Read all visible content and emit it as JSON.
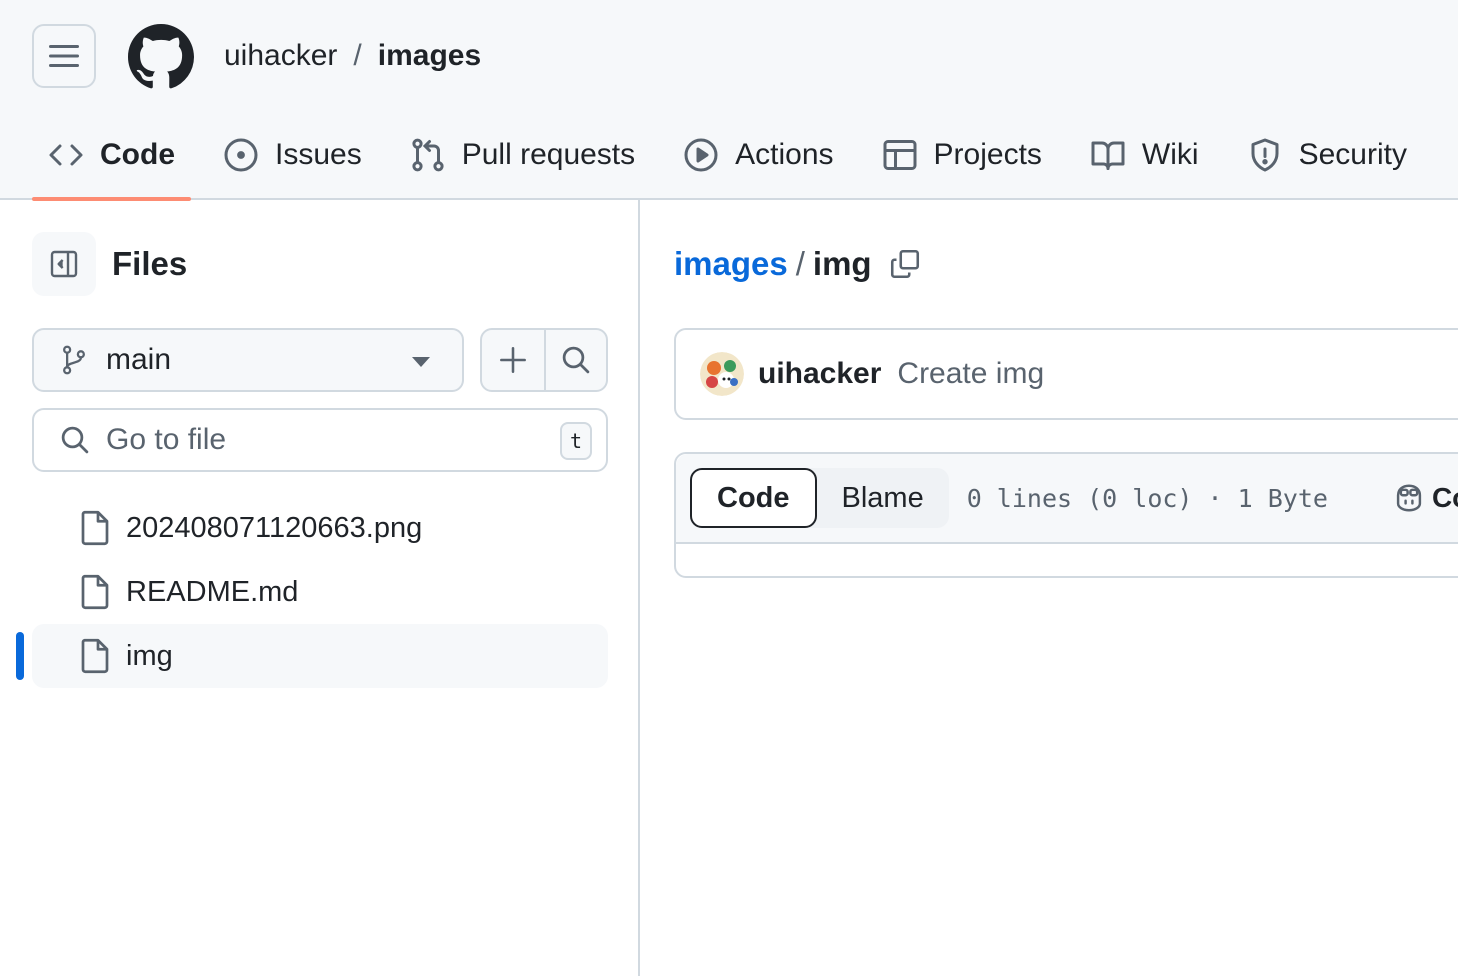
{
  "header": {
    "owner": "uihacker",
    "separator": "/",
    "repo": "images"
  },
  "tabs": [
    {
      "label": "Code",
      "icon": "code-icon",
      "active": true
    },
    {
      "label": "Issues",
      "icon": "issue-opened-icon"
    },
    {
      "label": "Pull requests",
      "icon": "git-pull-request-icon"
    },
    {
      "label": "Actions",
      "icon": "play-icon"
    },
    {
      "label": "Projects",
      "icon": "table-icon"
    },
    {
      "label": "Wiki",
      "icon": "book-icon"
    },
    {
      "label": "Security",
      "icon": "shield-icon"
    }
  ],
  "sidebar": {
    "title": "Files",
    "branch": "main",
    "goto_placeholder": "Go to file",
    "goto_shortcut": "t",
    "files": [
      {
        "name": "202408071120663.png"
      },
      {
        "name": "README.md"
      },
      {
        "name": "img",
        "selected": true
      }
    ]
  },
  "main": {
    "breadcrumb": {
      "repo": "images",
      "separator": "/",
      "file": "img"
    },
    "commit": {
      "author": "uihacker",
      "message": "Create img"
    },
    "file_header": {
      "view_code": "Code",
      "view_blame": "Blame",
      "meta": "0 lines (0 loc) · 1 Byte",
      "copilot_label": "Cod"
    }
  },
  "colors": {
    "accent_tab_underline": "#fd8c73",
    "link": "#0969da",
    "border": "#d1d9e0",
    "muted_text": "#59636e"
  }
}
